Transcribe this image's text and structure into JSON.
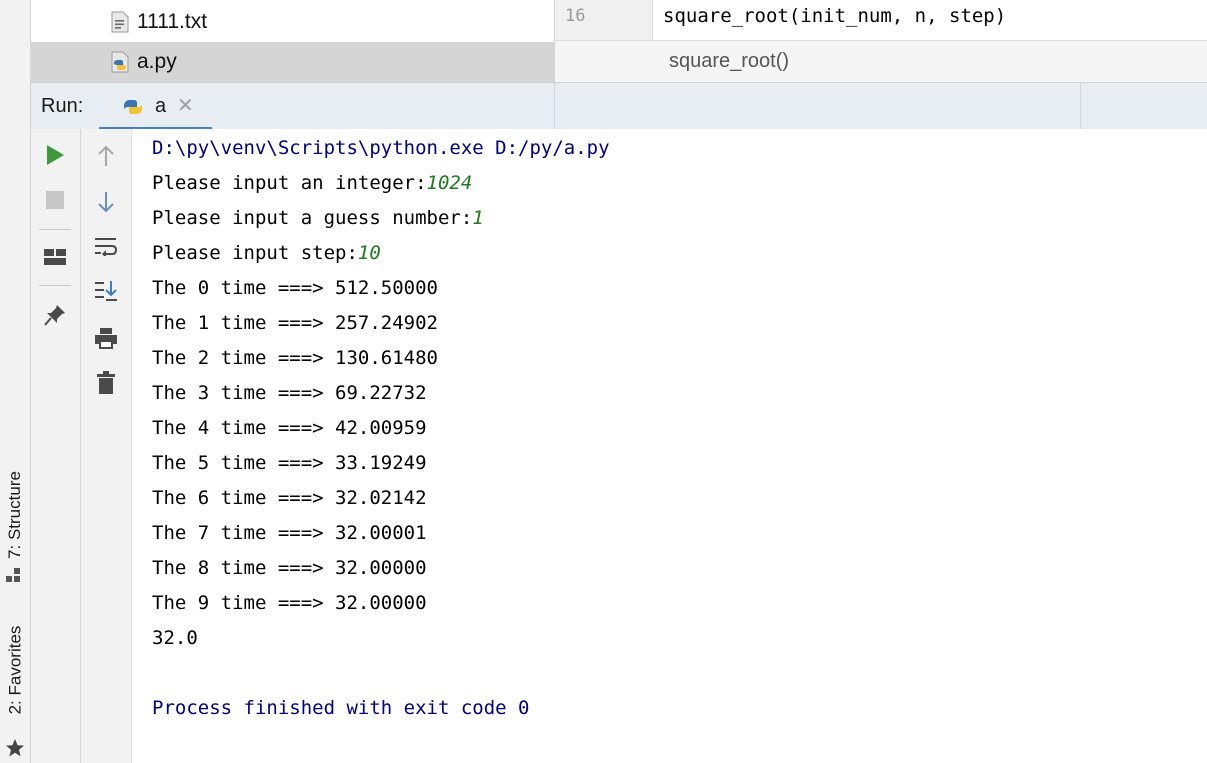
{
  "left_strip": {
    "structure_label": "7: Structure",
    "favorites_label": "2: Favorites"
  },
  "project_tree": {
    "items": [
      {
        "label": "1111.txt",
        "icon": "text-file-icon",
        "selected": false
      },
      {
        "label": "a.py",
        "icon": "python-file-icon",
        "selected": true
      }
    ]
  },
  "editor": {
    "line_number": "16",
    "code": "square_root(init_num, n, step)",
    "breadcrumb": "square_root()"
  },
  "run_window": {
    "run_label": "Run:",
    "tab_label": "a",
    "close_glyph": "✕"
  },
  "console": {
    "command": "D:\\py\\venv\\Scripts\\python.exe D:/py/a.py",
    "prompts": [
      {
        "text": "Please input an integer:",
        "input": "1024"
      },
      {
        "text": "Please input a guess number:",
        "input": "1"
      },
      {
        "text": "Please input step:",
        "input": "10"
      }
    ],
    "iterations": [
      "The 0 time ===> 512.50000",
      "The 1 time ===> 257.24902",
      "The 2 time ===> 130.61480",
      "The 3 time ===> 69.22732",
      "The 4 time ===> 42.00959",
      "The 5 time ===> 33.19249",
      "The 6 time ===> 32.02142",
      "The 7 time ===> 32.00001",
      "The 8 time ===> 32.00000",
      "The 9 time ===> 32.00000"
    ],
    "result": "32.0",
    "exit_message": "Process finished with exit code 0"
  },
  "colors": {
    "sys_text": "#000080",
    "user_input": "#1c7a1c",
    "run_green": "#3c9a3c",
    "tab_accent": "#4083c9"
  }
}
